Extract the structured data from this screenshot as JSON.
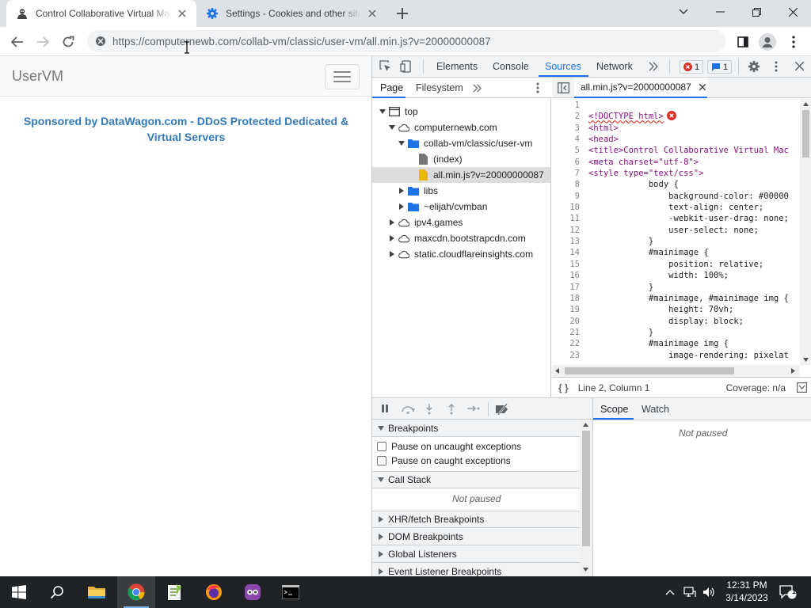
{
  "browser": {
    "tabs": [
      {
        "title": "Control Collaborative Virtual Mac",
        "active": true,
        "icon": "computernewb-favicon"
      },
      {
        "title": "Settings - Cookies and other site",
        "active": false,
        "icon": "gear-icon"
      }
    ],
    "url": "https://computernewb.com/collab-vm/classic/user-vm/all.min.js?v=20000000087"
  },
  "page": {
    "brand": "UserVM",
    "sponsor": "Sponsored by DataWagon.com - DDoS Protected Dedicated & Virtual Servers"
  },
  "devtools": {
    "panels": [
      "Elements",
      "Console",
      "Sources",
      "Network"
    ],
    "active_panel": "Sources",
    "error_count": "1",
    "message_count": "1",
    "navigator_tabs": [
      "Page",
      "Filesystem"
    ],
    "tree": [
      {
        "label": "top",
        "depth": 0,
        "kind": "frame",
        "expanded": true
      },
      {
        "label": "computernewb.com",
        "depth": 1,
        "kind": "cloud",
        "expanded": true
      },
      {
        "label": "collab-vm/classic/user-vm",
        "depth": 2,
        "kind": "folder",
        "expanded": true
      },
      {
        "label": "(index)",
        "depth": 3,
        "kind": "file"
      },
      {
        "label": "all.min.js?v=20000000087",
        "depth": 3,
        "kind": "jsfile",
        "selected": true
      },
      {
        "label": "libs",
        "depth": 2,
        "kind": "folder",
        "expanded": false
      },
      {
        "label": "~elijah/cvmban",
        "depth": 2,
        "kind": "folder",
        "expanded": false
      },
      {
        "label": "ipv4.games",
        "depth": 1,
        "kind": "cloud",
        "expanded": false
      },
      {
        "label": "maxcdn.bootstrapcdn.com",
        "depth": 1,
        "kind": "cloud",
        "expanded": false
      },
      {
        "label": "static.cloudflareinsights.com",
        "depth": 1,
        "kind": "cloud",
        "expanded": false
      }
    ],
    "open_file": "all.min.js?v=20000000087",
    "line_numbers": [
      "1",
      "2",
      "3",
      "4",
      "5",
      "6",
      "7",
      "8",
      "9",
      "10",
      "11",
      "12",
      "13",
      "14",
      "15",
      "16",
      "17",
      "18",
      "19",
      "20",
      "21",
      "22",
      "23"
    ],
    "code_lines": [
      "",
      "<!DOCTYPE html>",
      "<html>",
      "<head>",
      "<title>Control Collaborative Virtual Mac",
      "<meta charset=\"utf-8\">",
      "<style type=\"text/css\">",
      "            body {",
      "                background-color: #00000",
      "                text-align: center;",
      "                -webkit-user-drag: none;",
      "                user-select: none;",
      "            }",
      "            #mainimage {",
      "                position: relative;",
      "                width: 100%;",
      "            }",
      "            #mainimage, #mainimage img {",
      "                height: 70vh;",
      "                display: block;",
      "            }",
      "            #mainimage img {",
      "                image-rendering: pixelat"
    ],
    "cursor_position": "Line 2, Column 1",
    "coverage": "Coverage: n/a",
    "sections": {
      "breakpoints": "Breakpoints",
      "pause_uncaught": "Pause on uncaught exceptions",
      "pause_caught": "Pause on caught exceptions",
      "call_stack": "Call Stack",
      "not_paused": "Not paused",
      "xhr": "XHR/fetch Breakpoints",
      "dom": "DOM Breakpoints",
      "global": "Global Listeners",
      "event": "Event Listener Breakpoints"
    },
    "scope_tabs": [
      "Scope",
      "Watch"
    ],
    "scope_status": "Not paused"
  },
  "taskbar": {
    "time": "12:31 PM",
    "date": "3/14/2023",
    "notification_count": "1"
  },
  "colors": {
    "accent": "#1a73e8",
    "sponsor_link": "#337ab7",
    "error": "#d93025",
    "taskbar": "#1f2326"
  }
}
